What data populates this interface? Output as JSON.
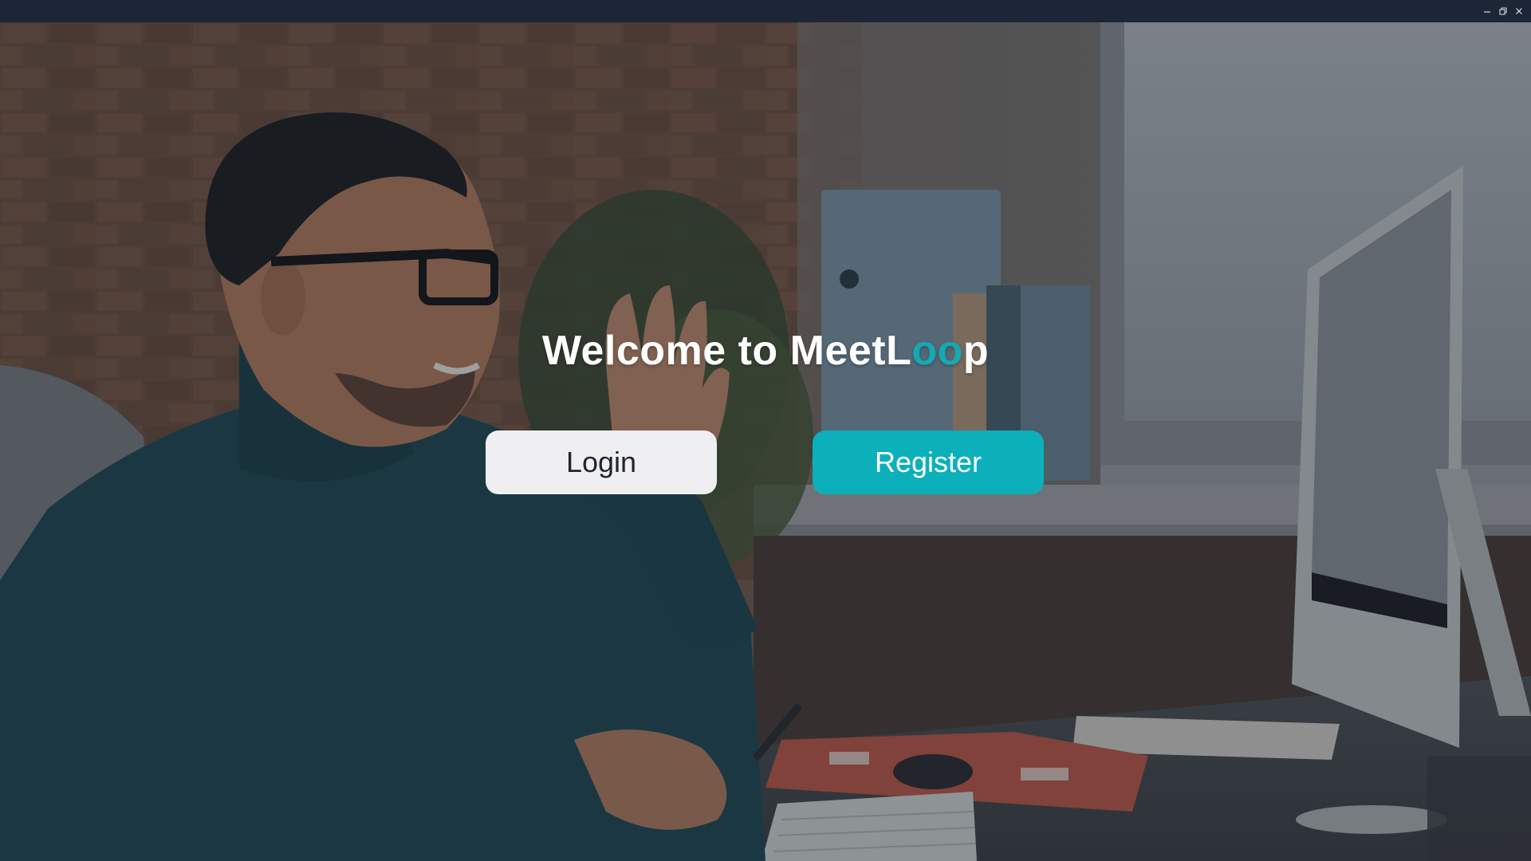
{
  "window": {
    "controls": {
      "minimize_icon": "minimize-icon",
      "restore_icon": "restore-icon",
      "close_icon": "close-icon"
    }
  },
  "hero": {
    "title_prefix": "Welcome to MeetL",
    "title_accent": "oo",
    "title_suffix": "p",
    "background": "photo of smiling man in teal turtleneck waving at desktop computer"
  },
  "actions": {
    "login_label": "Login",
    "register_label": "Register"
  },
  "colors": {
    "accent": "#12aab5",
    "register_button": "#0bb0ba",
    "login_button": "#efeff1",
    "titlebar": "#1d2636"
  }
}
